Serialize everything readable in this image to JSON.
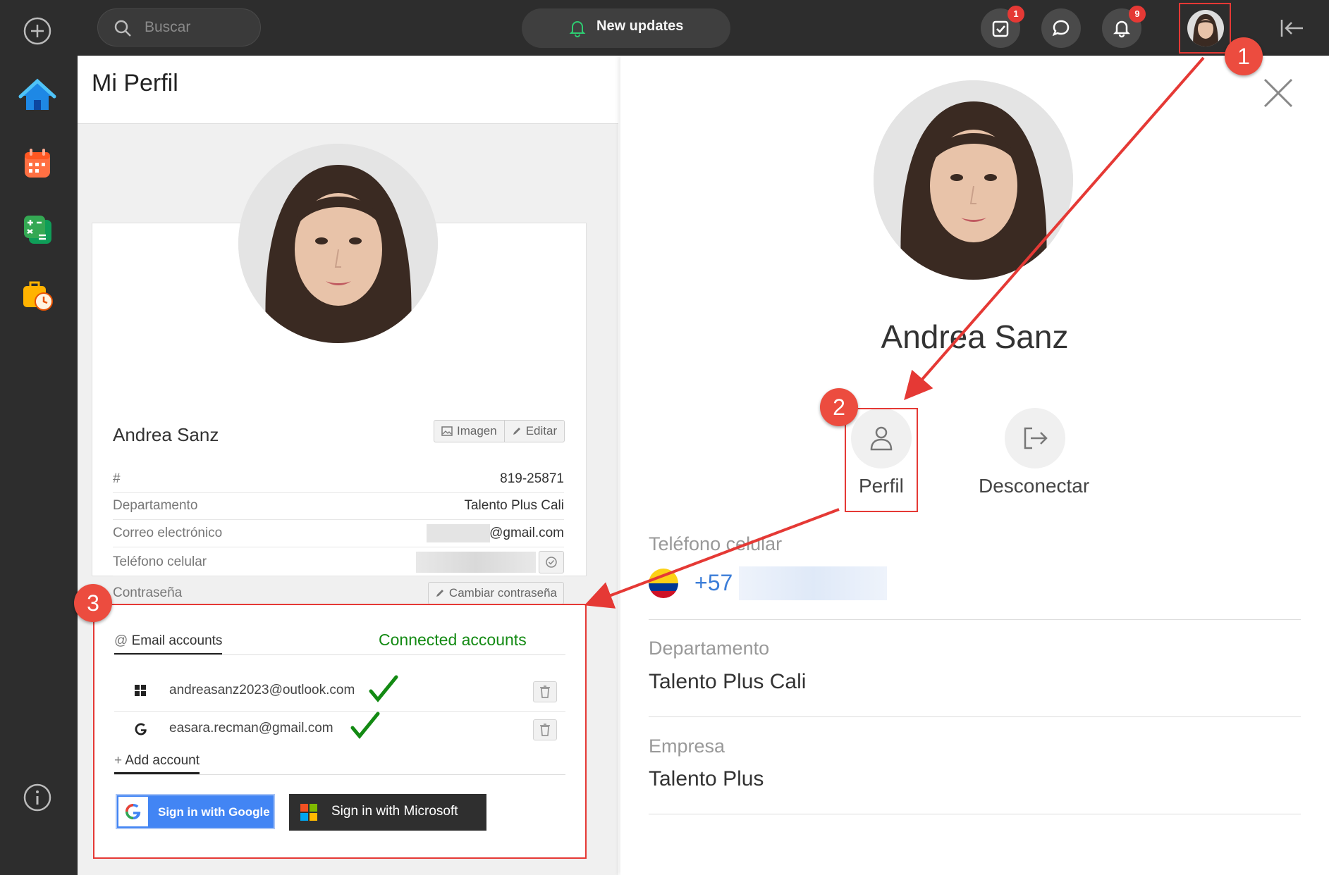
{
  "topbar": {
    "search_placeholder": "Buscar",
    "updates_label": "New updates",
    "tasks_badge": "1",
    "notifications_badge": "9"
  },
  "main": {
    "title": "Mi Perfil",
    "name": "Andrea Sanz",
    "image_button": "Imagen",
    "edit_button": "Editar",
    "fields": [
      {
        "label": "#",
        "value": "819-25871"
      },
      {
        "label": "Departamento",
        "value": "Talento Plus Cali"
      },
      {
        "label": "Correo electrónico",
        "value": "@gmail.com"
      },
      {
        "label": "Teléfono celular",
        "value": ""
      },
      {
        "label": "Contraseña",
        "value": ""
      }
    ],
    "change_password_button": "Cambiar contraseña"
  },
  "accounts": {
    "tab_label": "Email accounts",
    "connected_annotation": "Connected accounts",
    "items": [
      {
        "email": "andreasanz2023@outlook.com",
        "provider_icon": "microsoft-icon"
      },
      {
        "email": "easara.recman@gmail.com",
        "provider_icon": "google-icon"
      }
    ],
    "add_label": "Add account",
    "google_button": "Sign in with Google",
    "microsoft_button": "Sign in with Microsoft"
  },
  "profile_panel": {
    "name": "Andrea Sanz",
    "perfil_label": "Perfil",
    "disconnect_label": "Desconectar",
    "phone_label": "Teléfono celular",
    "phone_code": "+57",
    "department_label": "Departamento",
    "department_value": "Talento Plus Cali",
    "company_label": "Empresa",
    "company_value": "Talento Plus"
  },
  "annotations": {
    "step1": "1",
    "step2": "2",
    "step3": "3",
    "arrow_color": "#e53935"
  },
  "colors": {
    "sidebar_bg": "#2d2d2d",
    "accent_red": "#e53935",
    "connected_green": "#138a13",
    "phone_blue": "#3b7dd8"
  }
}
